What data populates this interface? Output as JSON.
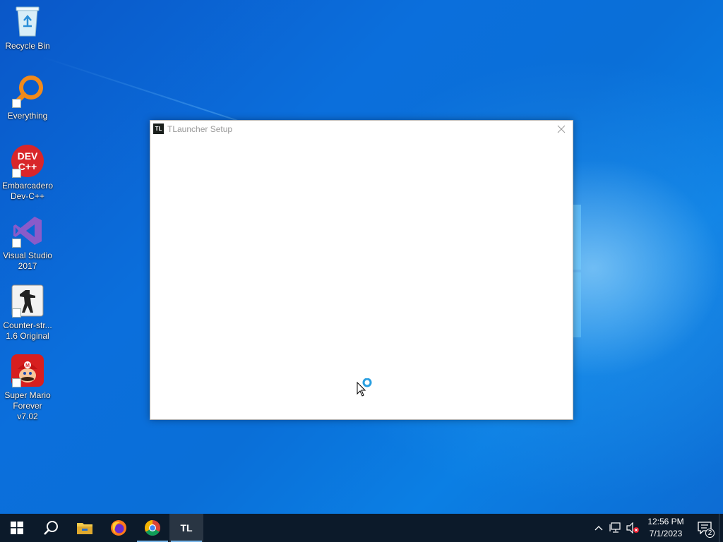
{
  "desktop": {
    "icons": [
      {
        "label": "Recycle Bin",
        "icon": "recycle-bin-icon"
      },
      {
        "label": "Everything",
        "icon": "magnifier-icon"
      },
      {
        "label": "Embarcadero\nDev-C++",
        "icon": "devcpp-icon"
      },
      {
        "label": "Visual Studio\n2017",
        "icon": "visual-studio-icon"
      },
      {
        "label": "Counter-str...\n1.6 Original",
        "icon": "counter-strike-icon"
      },
      {
        "label": "Super Mario\nForever v7.02",
        "icon": "mario-icon"
      }
    ]
  },
  "window": {
    "title": "TLauncher Setup",
    "app_icon_text": "TL"
  },
  "taskbar": {
    "pinned": [
      {
        "name": "start-button",
        "icon": "windows-logo-icon"
      },
      {
        "name": "search-button",
        "icon": "search-icon"
      },
      {
        "name": "file-explorer",
        "icon": "folder-icon"
      },
      {
        "name": "firefox",
        "icon": "firefox-icon"
      },
      {
        "name": "chrome",
        "icon": "chrome-icon"
      },
      {
        "name": "tlauncher",
        "icon": "tlauncher-icon",
        "text": "TL"
      }
    ],
    "clock": {
      "time": "12:56 PM",
      "date": "7/1/2023"
    },
    "notifications": {
      "count": "2"
    }
  },
  "colors": {
    "taskbar": "#0c1a2a",
    "desktop_blue": "#0b6fdc",
    "running_indicator": "#78b6ea"
  }
}
